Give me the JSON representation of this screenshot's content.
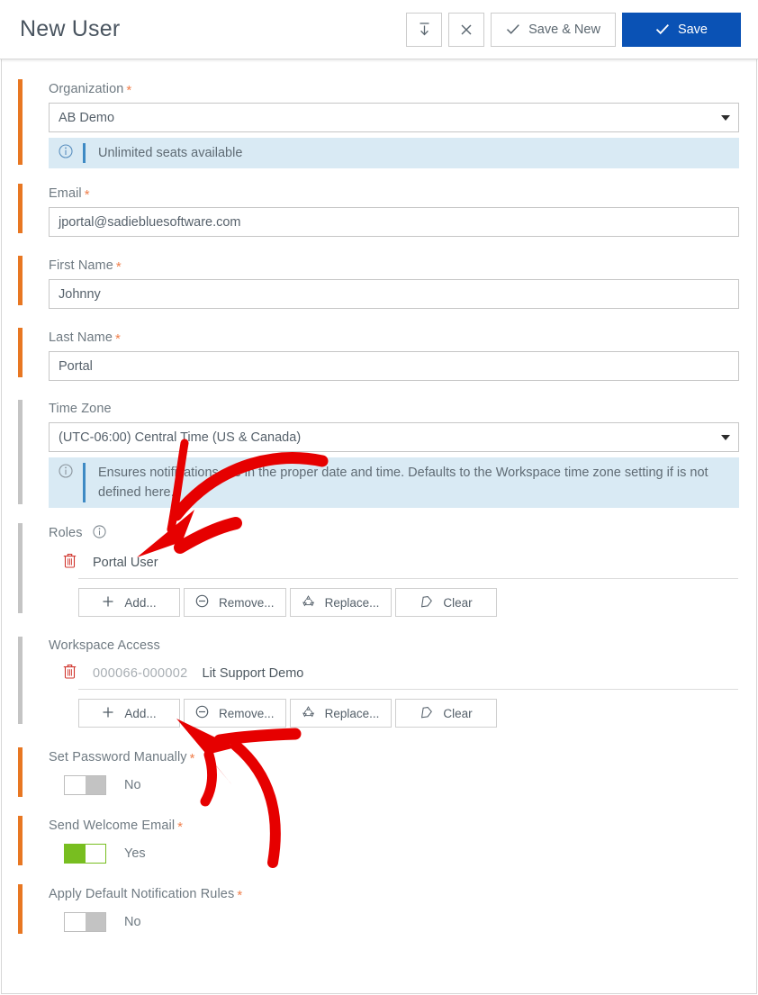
{
  "header": {
    "title": "New User",
    "actions": [
      {
        "name": "collapse-button",
        "label": "",
        "icon": "download-bar-icon"
      },
      {
        "name": "close-button",
        "label": "",
        "icon": "close-icon"
      },
      {
        "name": "save-and-new-button",
        "label": "Save & New",
        "icon": "check-icon"
      },
      {
        "name": "save-button",
        "label": "Save",
        "icon": "check-icon"
      }
    ]
  },
  "form": {
    "organization": {
      "label": "Organization",
      "required": true,
      "value": "AB Demo",
      "banner": "Unlimited seats available"
    },
    "email": {
      "label": "Email",
      "required": true,
      "value": "jportal@sadiebluesoftware.com"
    },
    "first_name": {
      "label": "First Name",
      "required": true,
      "value": "Johnny"
    },
    "last_name": {
      "label": "Last Name",
      "required": true,
      "value": "Portal"
    },
    "time_zone": {
      "label": "Time Zone",
      "required": false,
      "value": "(UTC-06:00) Central Time (US & Canada)",
      "banner": "Ensures notifications are in the proper date and time. Defaults to the Workspace time zone setting if is not defined here."
    },
    "roles": {
      "label": "Roles",
      "required": false,
      "has_info_icon": true,
      "items": [
        {
          "code": "",
          "name": "Portal User"
        }
      ],
      "buttons": [
        {
          "label": "Add...",
          "icon": "plus-icon"
        },
        {
          "label": "Remove...",
          "icon": "minus-circle-icon"
        },
        {
          "label": "Replace...",
          "icon": "recycle-icon"
        },
        {
          "label": "Clear",
          "icon": "eraser-icon"
        }
      ]
    },
    "workspace_access": {
      "label": "Workspace Access",
      "required": false,
      "items": [
        {
          "code": "000066-000002",
          "name": "Lit Support Demo"
        }
      ],
      "buttons": [
        {
          "label": "Add...",
          "icon": "plus-icon"
        },
        {
          "label": "Remove...",
          "icon": "minus-circle-icon"
        },
        {
          "label": "Replace...",
          "icon": "recycle-icon"
        },
        {
          "label": "Clear",
          "icon": "eraser-icon"
        }
      ]
    },
    "set_password_manually": {
      "label": "Set Password Manually",
      "required": true,
      "state": "No"
    },
    "send_welcome_email": {
      "label": "Send Welcome Email",
      "required": true,
      "state": "Yes"
    },
    "apply_default_notification_rules": {
      "label": "Apply Default Notification Rules",
      "required": true,
      "state": "No"
    }
  },
  "annotations": {
    "arrow_1": "points to Roles section",
    "arrow_2": "points to Workspace Access Remove button"
  },
  "colors": {
    "primary_button": "#0a52b5",
    "required_accent": "#e87722",
    "optional_accent": "#c4c4c4",
    "info_banner_bg": "#d9eaf4",
    "toggle_on": "#78be20",
    "annotation": "#e60000"
  }
}
